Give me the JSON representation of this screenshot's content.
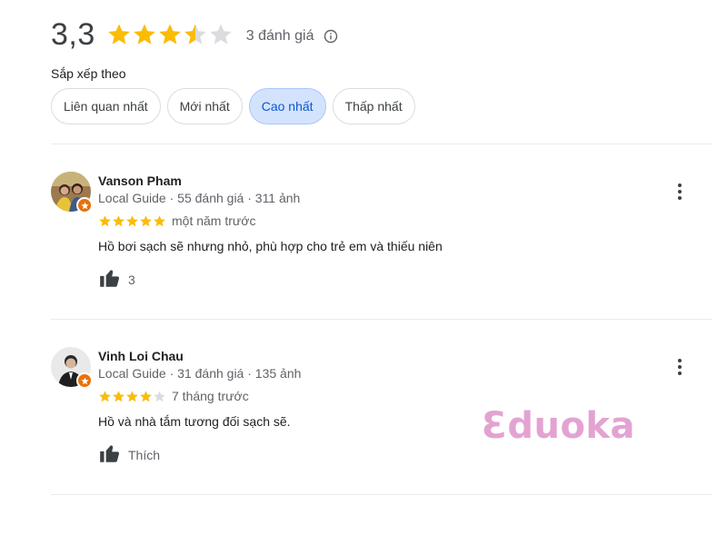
{
  "summary": {
    "rating": "3,3",
    "stars": 3.5,
    "count_label": "3 đánh giá",
    "info_icon": "info-icon"
  },
  "sort": {
    "label": "Sắp xếp theo",
    "options": [
      "Liên quan nhất",
      "Mới nhất",
      "Cao nhất",
      "Thấp nhất"
    ],
    "selected": "Cao nhất"
  },
  "reviews": [
    {
      "name": "Vanson Pham",
      "meta": "Local Guide · 55 đánh giá · 311 ảnh",
      "stars": 5,
      "date": "một năm trước",
      "text": "Hồ bơi sạch sẽ nhưng nhỏ, phù hợp cho trẻ em và thiếu niên",
      "likes": "3"
    },
    {
      "name": "Vinh Loi Chau",
      "meta": "Local Guide · 31 đánh giá · 135 ảnh",
      "stars": 4,
      "date": "7 tháng trước",
      "text": "Hồ và nhà tắm tương đối sạch sẽ.",
      "likes": "Thích"
    }
  ],
  "watermark": "Ɛduoka",
  "colors": {
    "star_filled": "#fbbc04",
    "star_empty": "#dadce0",
    "chip_active_bg": "#d3e3fd",
    "chip_active_text": "#0b57d0",
    "badge": "#e8710a",
    "watermark": "#e3a3d2"
  }
}
